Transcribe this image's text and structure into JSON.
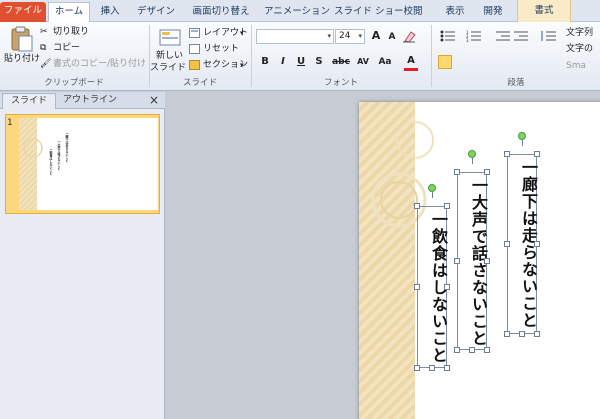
{
  "tabs": {
    "file": "ファイル",
    "home": "ホーム",
    "insert": "挿入",
    "design": "デザイン",
    "transitions": "画面切り替え",
    "animations": "アニメーション",
    "slideshow": "スライド ショー",
    "review": "校閲",
    "view": "表示",
    "developer": "開発",
    "format": "書式"
  },
  "ribbon": {
    "clipboard": {
      "paste": "貼り付け",
      "cut": "切り取り",
      "copy": "コピー",
      "format_painter": "書式のコピー/貼り付け",
      "label": "クリップボード"
    },
    "slides": {
      "new_slide_1": "新しい",
      "new_slide_2": "スライド",
      "layout": "レイアウト",
      "reset": "リセット",
      "section": "セクション",
      "label": "スライド"
    },
    "font": {
      "font_name": "",
      "font_size": "24",
      "grow": "A",
      "shrink": "A",
      "bold": "B",
      "italic": "I",
      "underline": "U",
      "strike": "S",
      "abc": "abc",
      "spacing": "AV",
      "case": "Aa",
      "color": "A",
      "label": "フォント"
    },
    "paragraph": {
      "label": "段落",
      "text_dir": "文字列",
      "text_align": "文字の",
      "smartart": "Sma"
    }
  },
  "pane": {
    "tab_slides": "スライド",
    "tab_outline": "アウトライン",
    "close": "×",
    "slide_number": "1"
  },
  "slide": {
    "rules": [
      "一廊下は走らないこと",
      "一大声で話さないこと",
      "一飲食はしないこと"
    ]
  },
  "colors": {
    "file_tab": "#e0502e",
    "accent_selected": "#fbd970",
    "band": "#f3e4bf"
  }
}
